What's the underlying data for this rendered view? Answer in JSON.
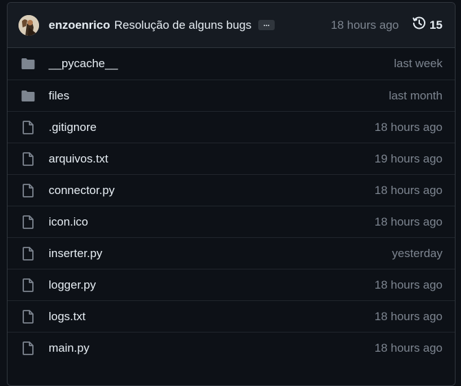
{
  "commit": {
    "author": "enzoenrico",
    "message": "Resolução de alguns bugs",
    "ellipsis": "...",
    "time": "18 hours ago",
    "history_count": "15",
    "history_icon": "history-clock-icon"
  },
  "colors": {
    "background": "#0d1117",
    "header_background": "#161b22",
    "border": "#30363d",
    "text": "#e6edf3",
    "muted_text": "#7d8590",
    "folder_icon": "#7d8590"
  },
  "files": [
    {
      "name": "__pycache__",
      "type": "folder",
      "icon": "folder-icon",
      "time": "last week"
    },
    {
      "name": "files",
      "type": "folder",
      "icon": "folder-icon",
      "time": "last month"
    },
    {
      "name": ".gitignore",
      "type": "file",
      "icon": "file-icon",
      "time": "18 hours ago"
    },
    {
      "name": "arquivos.txt",
      "type": "file",
      "icon": "file-icon",
      "time": "19 hours ago"
    },
    {
      "name": "connector.py",
      "type": "file",
      "icon": "file-icon",
      "time": "18 hours ago"
    },
    {
      "name": "icon.ico",
      "type": "file",
      "icon": "file-icon",
      "time": "18 hours ago"
    },
    {
      "name": "inserter.py",
      "type": "file",
      "icon": "file-icon",
      "time": "yesterday"
    },
    {
      "name": "logger.py",
      "type": "file",
      "icon": "file-icon",
      "time": "18 hours ago"
    },
    {
      "name": "logs.txt",
      "type": "file",
      "icon": "file-icon",
      "time": "18 hours ago"
    },
    {
      "name": "main.py",
      "type": "file",
      "icon": "file-icon",
      "time": "18 hours ago"
    }
  ]
}
